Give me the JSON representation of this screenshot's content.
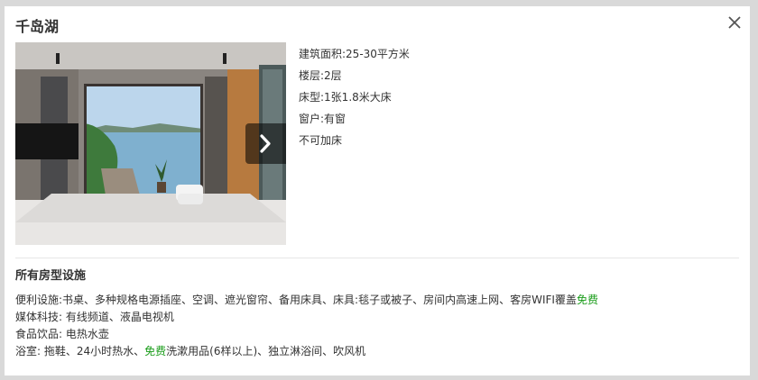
{
  "title": "千岛湖",
  "close_icon": "close-icon",
  "photo": {
    "next_icon": "chevron-right-icon"
  },
  "room_info": {
    "area": "建筑面积:25-30平方米",
    "floor": "楼层:2层",
    "bed": "床型:1张1.8米大床",
    "window": "窗户:有窗",
    "extra_bed": "不可加床"
  },
  "facilities": {
    "section_title": "所有房型设施",
    "convenience": {
      "label": "便利设施:",
      "items": "书桌、多种规格电源插座、空调、遮光窗帘、备用床具、床具:毯子或被子、房间内高速上网、客房WIFI覆盖",
      "free": "免费"
    },
    "media": {
      "label": "媒体科技:",
      "items": "有线频道、液晶电视机"
    },
    "food": {
      "label": "食品饮品:",
      "items": "电热水壶"
    },
    "bathroom": {
      "label": "浴室:",
      "items_before": "拖鞋、24小时热水、",
      "free": "免费",
      "items_after": "洗漱用品(6样以上)、独立淋浴间、吹风机"
    }
  },
  "colors": {
    "free_text": "#1a9c1a",
    "background": "#d9d9d9",
    "panel": "#ffffff"
  }
}
